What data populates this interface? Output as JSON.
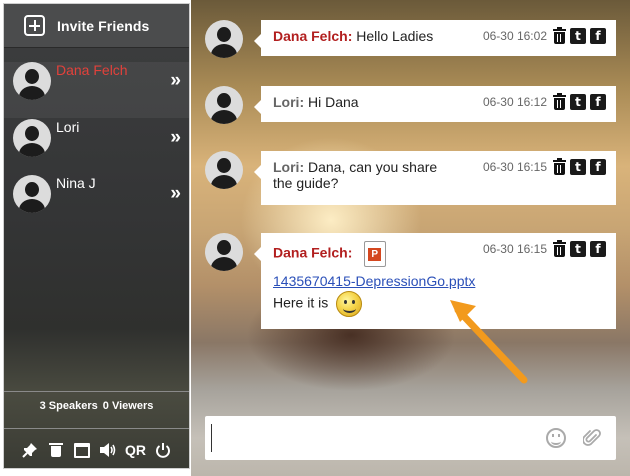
{
  "sidebar": {
    "invite_label": "Invite Friends",
    "users": [
      {
        "name": "Dana Felch",
        "highlight": true
      },
      {
        "name": "Lori",
        "highlight": false
      },
      {
        "name": "Nina J",
        "highlight": false
      }
    ],
    "chevron": "»",
    "stats": {
      "speakers_count": "3",
      "speakers_label": "Speakers",
      "viewers_count": "0",
      "viewers_label": "Viewers"
    },
    "toolbar": {
      "pin_icon": "pin-icon",
      "trash_icon": "trash-icon",
      "window_icon": "window-icon",
      "volume_icon": "volume-icon",
      "qr_label": "QR",
      "power_icon": "power-icon"
    }
  },
  "messages": [
    {
      "sender": "Dana Felch:",
      "text": "Hello Ladies",
      "time": "06-30 16:02"
    },
    {
      "sender": "Lori:",
      "text": "Hi Dana",
      "time": "06-30 16:12"
    },
    {
      "sender": "Lori:",
      "text": "Dana, can you share the guide?",
      "time": "06-30 16:15"
    },
    {
      "sender": "Dana Felch:",
      "file_name": "1435670415-DepressionGo.pptx",
      "text": "Here it is",
      "time": "06-30 16:15"
    }
  ],
  "social": {
    "twitter": "t",
    "facebook": "f"
  },
  "composer": {
    "placeholder": ""
  },
  "colors": {
    "sender_red": "#b21f1f",
    "highlight_name": "#e2413b",
    "link": "#2a4fb8",
    "arrow": "#f29a1d"
  }
}
